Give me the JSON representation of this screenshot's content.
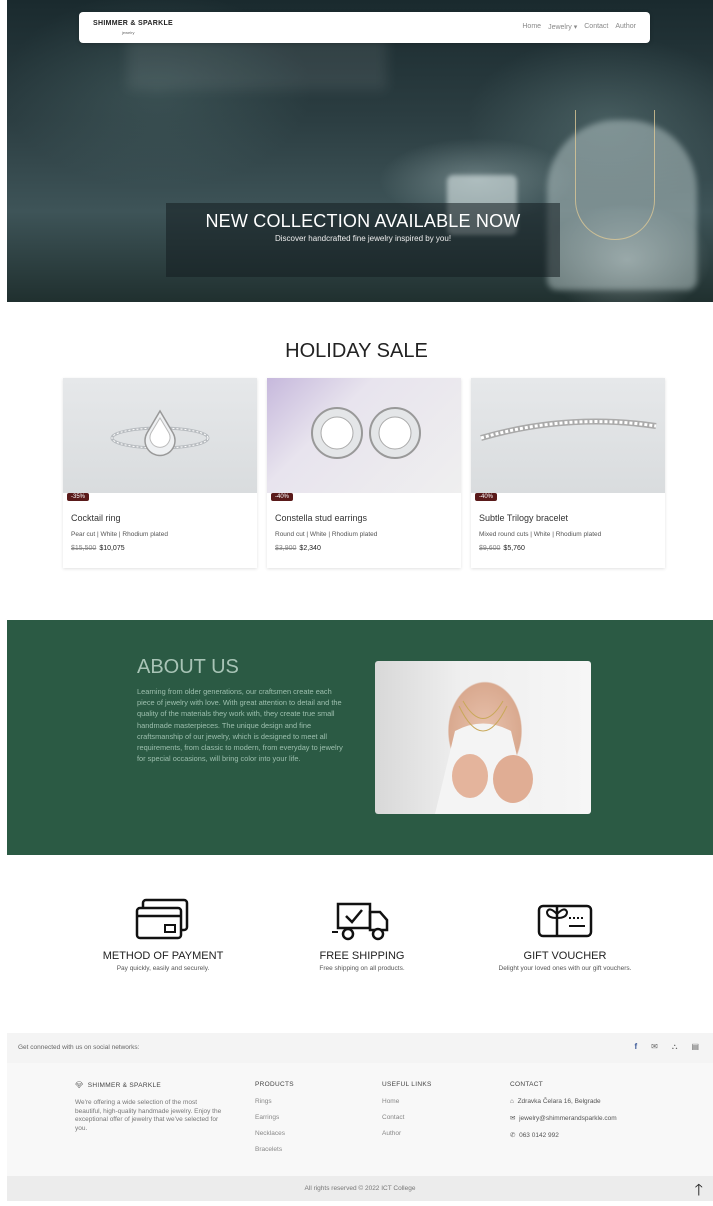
{
  "nav": {
    "brand": "SHIMMER & SPARKLE",
    "brand_sub": "jewelry",
    "links": [
      "Home",
      "Jewelry ▾",
      "Contact",
      "Author"
    ]
  },
  "hero": {
    "title": "NEW COLLECTION AVAILABLE NOW",
    "subtitle": "Discover handcrafted fine jewelry inspired by you!"
  },
  "sale": {
    "title": "HOLIDAY SALE",
    "products": [
      {
        "discount": "-35%",
        "name": "Cocktail ring",
        "desc": "Pear cut | White | Rhodium plated",
        "old_price": "$15,500",
        "price": "$10,075"
      },
      {
        "discount": "-40%",
        "name": "Constella stud earrings",
        "desc": "Round cut | White | Rhodium plated",
        "old_price": "$3,900",
        "price": "$2,340"
      },
      {
        "discount": "-40%",
        "name": "Subtle Trilogy bracelet",
        "desc": "Mixed round cuts | White | Rhodium plated",
        "old_price": "$9,600",
        "price": "$5,760"
      }
    ]
  },
  "about": {
    "title": "ABOUT US",
    "text": "Learning from older generations, our craftsmen create each piece of jewelry with love. With great attention to detail and the quality of the materials they work with, they create true small handmade masterpieces. The unique design and fine craftsmanship of our jewelry, which is designed to meet all requirements, from classic to modern, from everyday to jewelry for special occasions, will bring color into your life."
  },
  "features": [
    {
      "icon": "credit-card-icon",
      "title": "METHOD OF PAYMENT",
      "text": "Pay quickly, easily and securely."
    },
    {
      "icon": "delivery-truck-icon",
      "title": "FREE SHIPPING",
      "text": "Free shipping on all products."
    },
    {
      "icon": "gift-voucher-icon",
      "title": "GIFT VOUCHER",
      "text": "Delight your loved ones with our gift vouchers."
    }
  ],
  "footer": {
    "social_msg": "Get connected with us on social networks:",
    "socials": [
      "f",
      "✉",
      "⛬",
      "▤"
    ],
    "brand": "SHIMMER & SPARKLE",
    "brand_icon": "gem-icon",
    "brand_text": "We're offering a wide selection of the most beautiful, high-quality handmade jewelry. Enjoy the exceptional offer of jewelry that we've selected for you.",
    "products_title": "PRODUCTS",
    "products": [
      "Rings",
      "Earrings",
      "Necklaces",
      "Bracelets"
    ],
    "links_title": "USEFUL LINKS",
    "links": [
      "Home",
      "Contact",
      "Author"
    ],
    "contact_title": "CONTACT",
    "contact": [
      {
        "icon": "home-icon",
        "glyph": "⌂",
        "text": "Zdravka Čelara 16, Belgrade"
      },
      {
        "icon": "envelope-icon",
        "glyph": "✉",
        "text": "jewelry@shimmerandsparkle.com"
      },
      {
        "icon": "phone-icon",
        "glyph": "✆",
        "text": "063 0142 992"
      }
    ],
    "copyright": "All rights reserved © 2022 ICT College",
    "back_to_top": "🡑"
  }
}
